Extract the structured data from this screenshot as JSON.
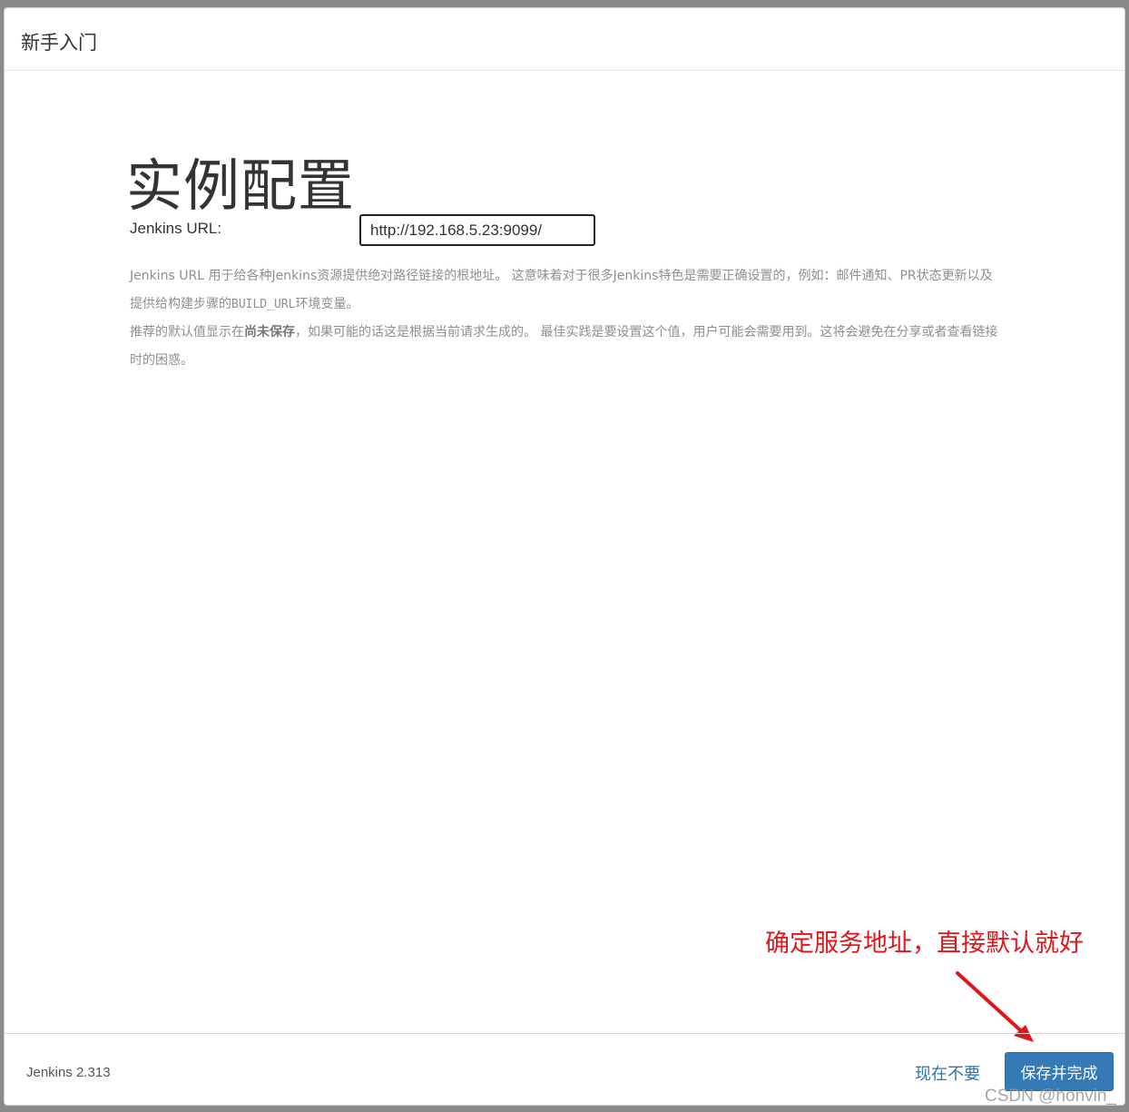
{
  "dialog": {
    "title": "新手入门"
  },
  "main": {
    "heading": "实例配置",
    "url_label": "Jenkins URL:",
    "url_value": "http://192.168.5.23:9099/",
    "help_line1_a": "Jenkins URL 用于给各种Jenkins资源提供绝对路径链接的根地址。 这意味着对于很多Jenkins特色是需要正确设置的，例如：邮件通知、PR状态更新以及提供给构建步骤的",
    "help_line1_code": "BUILD_URL",
    "help_line1_b": "环境变量。",
    "help_line2_a": "推荐的默认值显示在",
    "help_line2_bold": "尚未保存",
    "help_line2_b": "，如果可能的话这是根据当前请求生成的。 最佳实践是要设置这个值，用户可能会需要用到。这将会避免在分享或者查看链接时的困惑。"
  },
  "annotation": {
    "text": "确定服务地址，直接默认就好",
    "color": "#e0161b"
  },
  "footer": {
    "version": "Jenkins 2.313",
    "skip_label": "现在不要",
    "save_label": "保存并完成"
  },
  "watermark": "CSDN @honvin_",
  "colors": {
    "primary": "#337ab7",
    "link": "#2f73b0"
  }
}
